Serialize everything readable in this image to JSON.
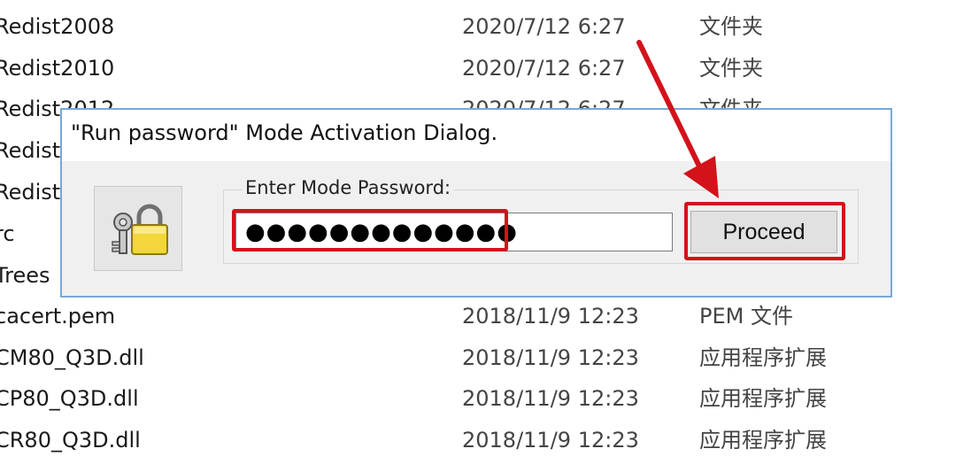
{
  "files": [
    {
      "name": "Redist2008",
      "date": "2020/7/12 6:27",
      "type": "文件夹"
    },
    {
      "name": "Redist2010",
      "date": "2020/7/12 6:27",
      "type": "文件夹"
    },
    {
      "name": "Redist2012",
      "date": "2020/7/12 6:27",
      "type": "文件夹"
    },
    {
      "name": "Redist",
      "date": "",
      "type": ""
    },
    {
      "name": "Redist",
      "date": "",
      "type": ""
    },
    {
      "name": "rc",
      "date": "",
      "type": ""
    },
    {
      "name": "Trees",
      "date": "",
      "type": ""
    },
    {
      "name": "cacert.pem",
      "date": "2018/11/9 12:23",
      "type": "PEM 文件"
    },
    {
      "name": "CM80_Q3D.dll",
      "date": "2018/11/9 12:23",
      "type": "应用程序扩展"
    },
    {
      "name": "CP80_Q3D.dll",
      "date": "2018/11/9 12:23",
      "type": "应用程序扩展"
    },
    {
      "name": "CR80_Q3D.dll",
      "date": "2018/11/9 12:23",
      "type": "应用程序扩展"
    }
  ],
  "dialog": {
    "title": "\"Run password\" Mode Activation Dialog.",
    "group_label": "Enter Mode Password:",
    "password_value": "●●●●●●●●●●●●●",
    "proceed_label": "Proceed",
    "icon": "lock-key-icon"
  },
  "colors": {
    "highlight": "#d3121a",
    "dialog_border": "#7aa7d8"
  }
}
